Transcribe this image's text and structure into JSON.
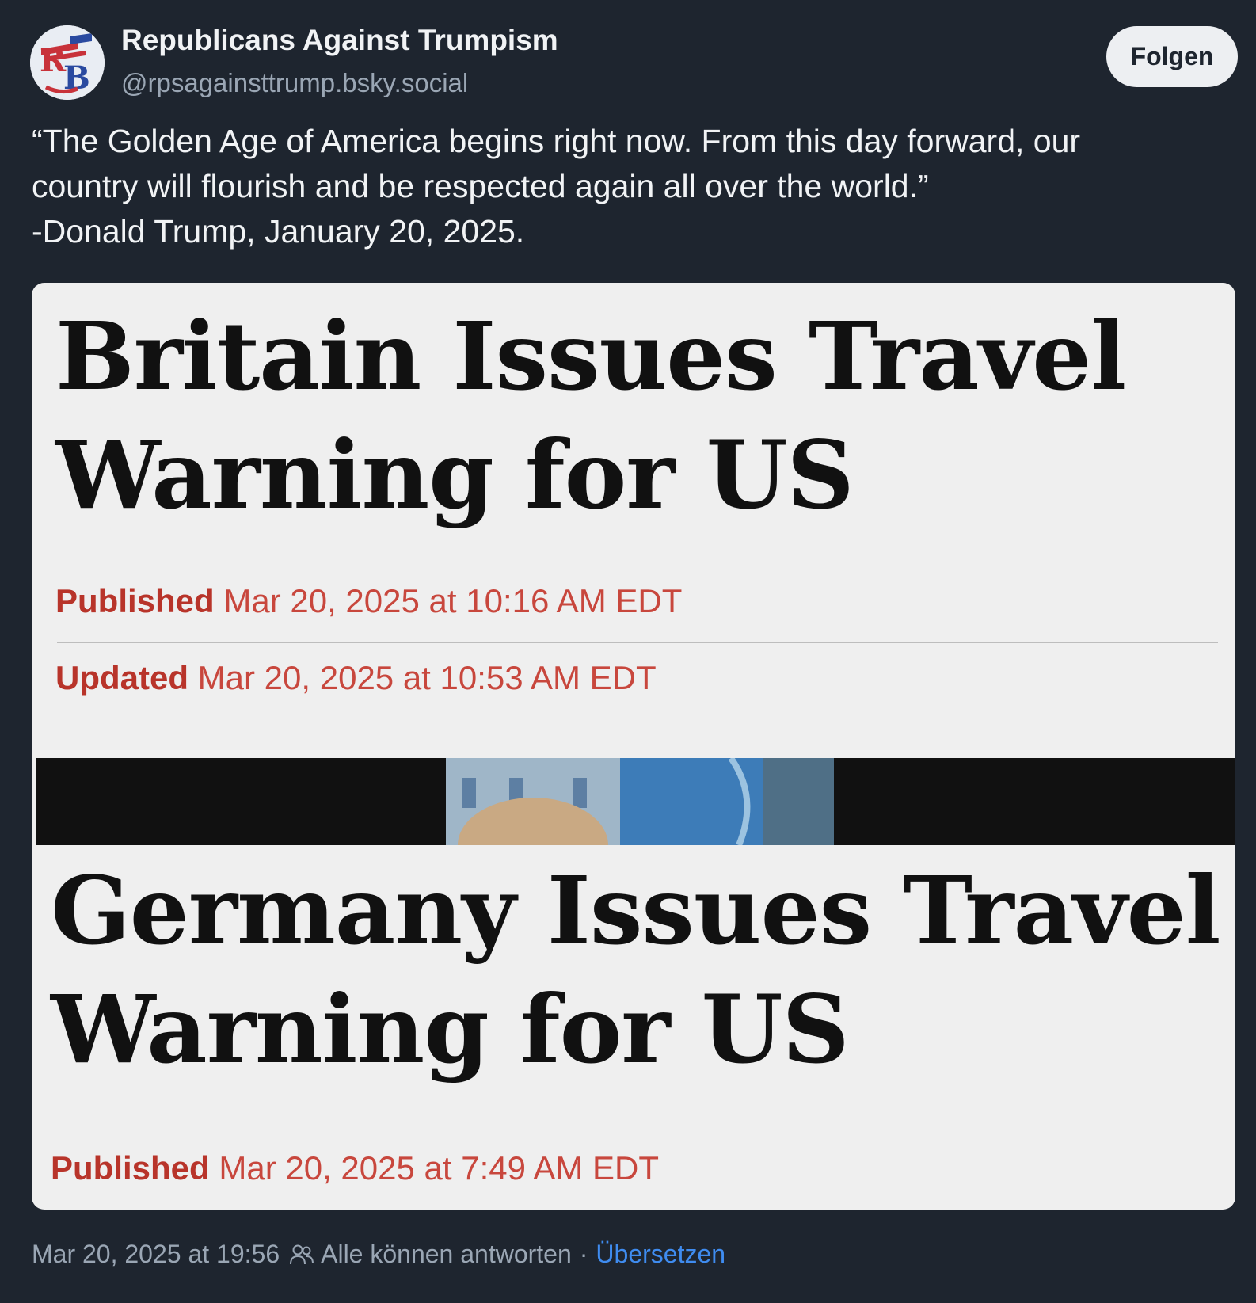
{
  "author": {
    "name": "Republicans Against Trumpism",
    "handle": "@rpsagainsttrump.bsky.social",
    "avatar_letters": "RB"
  },
  "follow_label": "Folgen",
  "post_text": {
    "line1": "“The Golden Age of America begins right now. From this day forward, our",
    "line2": "country will flourish and be respected again all over the world.”",
    "line3": "-Donald Trump, January 20, 2025."
  },
  "embed": {
    "headline1": {
      "line1": "Britain Issues Travel",
      "line2": "Warning for US"
    },
    "published1": {
      "label": "Published",
      "value": " Mar 20, 2025 at 10:16 AM EDT"
    },
    "updated1": {
      "label": "Updated",
      "value": " Mar 20, 2025 at 10:53 AM EDT"
    },
    "headline2": {
      "line1": "Germany Issues Travel",
      "line2": "Warning for US"
    },
    "published2": {
      "label": "Published",
      "value": " Mar 20, 2025 at 7:49 AM EDT"
    }
  },
  "footer": {
    "timestamp": "Mar 20, 2025 at 19:56",
    "people_icon": "people-icon",
    "reply_setting": "Alle können antworten",
    "separator": "·",
    "translate": "Übersetzen"
  },
  "colors": {
    "background": "#1e252f",
    "accent_link": "#3f8cf0",
    "meta_red": "#c8473d"
  }
}
